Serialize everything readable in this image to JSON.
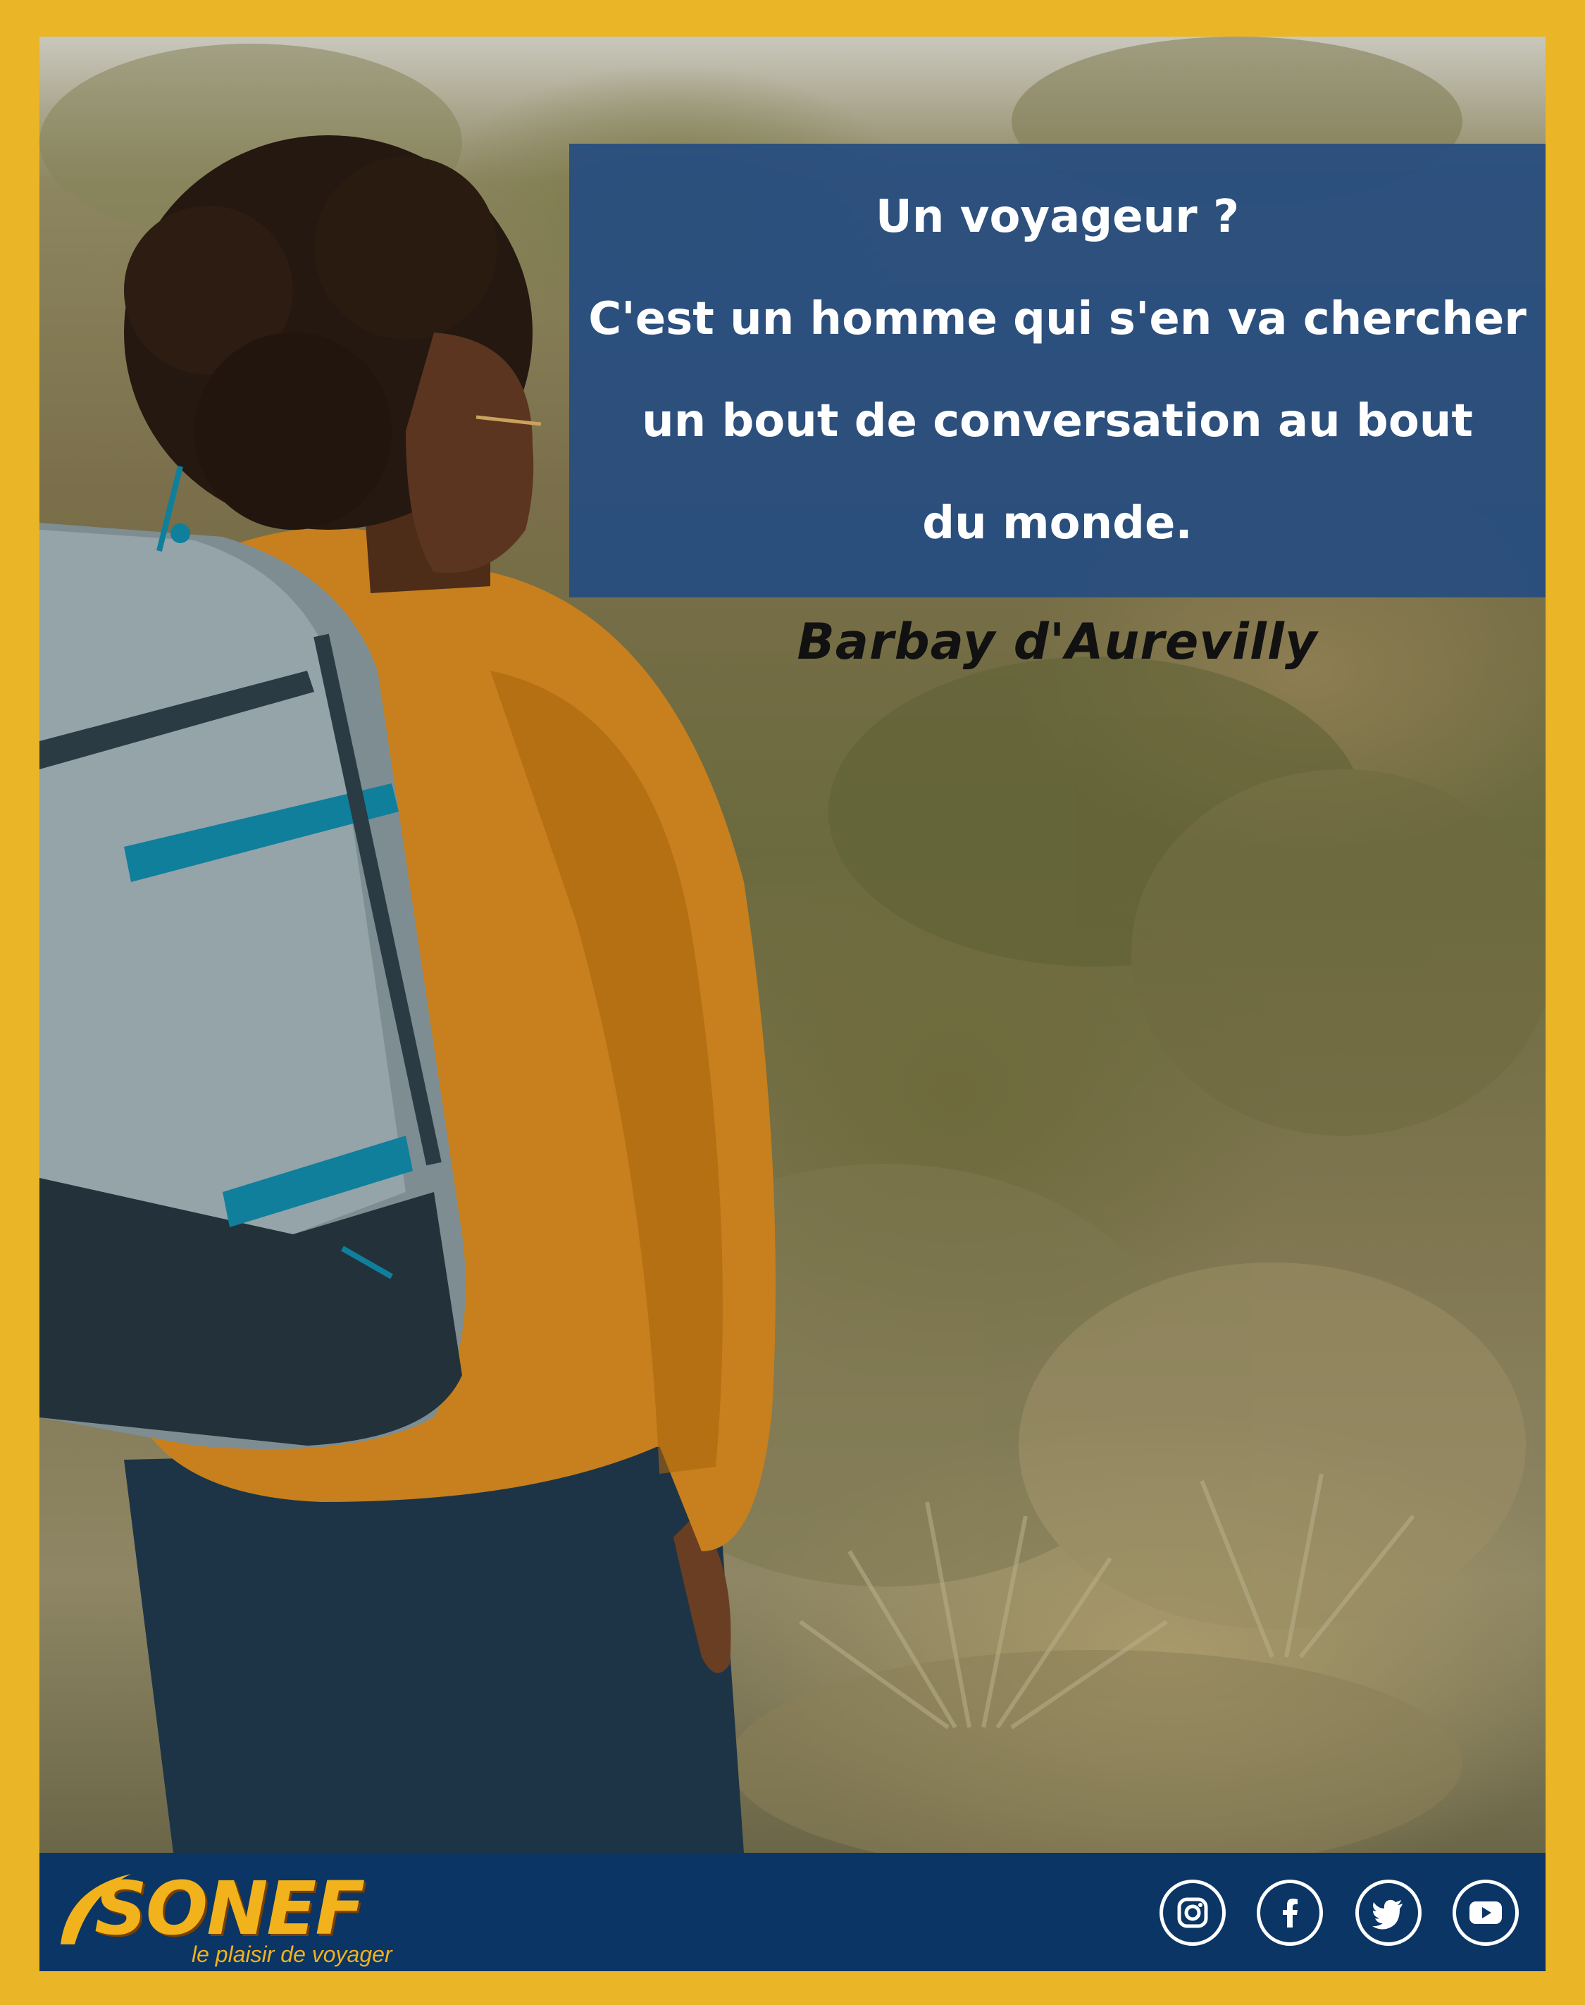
{
  "quote": {
    "lines": [
      "Un voyageur ?",
      "C'est un homme qui s'en va chercher",
      "un bout de conversation au bout",
      "du monde."
    ],
    "author": "Barbay d'Aurevilly"
  },
  "brand": {
    "name": "SONEF",
    "tagline": "le plaisir de voyager"
  },
  "social": [
    "instagram-icon",
    "facebook-icon",
    "twitter-icon",
    "youtube-icon"
  ],
  "colors": {
    "frame": "#eab526",
    "quote_box": "#264c80",
    "footer": "#0a3565",
    "brand_gold": "#f2b21b"
  }
}
